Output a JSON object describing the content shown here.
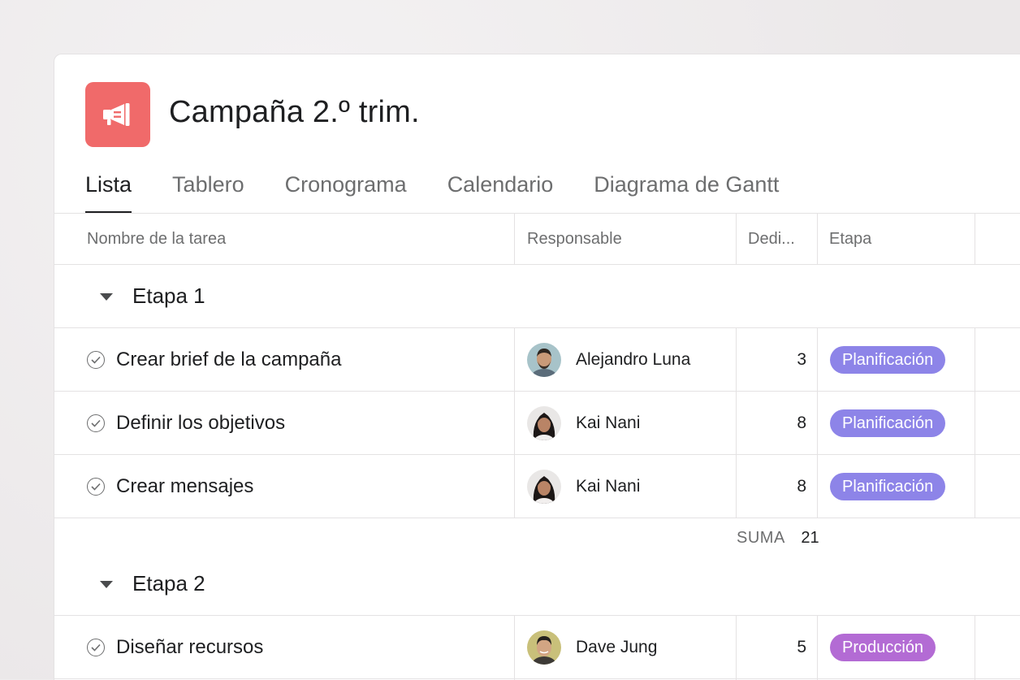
{
  "project": {
    "title": "Campaña 2.º trim.",
    "icon": "megaphone-icon",
    "icon_color": "#f06a6a"
  },
  "tabs": [
    {
      "label": "Lista",
      "active": true
    },
    {
      "label": "Tablero",
      "active": false
    },
    {
      "label": "Cronograma",
      "active": false
    },
    {
      "label": "Calendario",
      "active": false
    },
    {
      "label": "Diagrama de Gantt",
      "active": false
    }
  ],
  "columns": {
    "task": "Nombre de la tarea",
    "assignee": "Responsable",
    "effort": "Dedi...",
    "stage": "Etapa"
  },
  "sections": [
    {
      "label": "Etapa 1",
      "tasks": [
        {
          "name": "Crear brief de la campaña",
          "assignee": "Alejandro Luna",
          "effort": "3",
          "stage": "Planificación"
        },
        {
          "name": "Definir los objetivos",
          "assignee": "Kai Nani",
          "effort": "8",
          "stage": "Planificación"
        },
        {
          "name": "Crear mensajes",
          "assignee": "Kai Nani",
          "effort": "8",
          "stage": "Planificación"
        }
      ],
      "sum_label": "SUMA",
      "sum_value": "21"
    },
    {
      "label": "Etapa 2",
      "tasks": [
        {
          "name": "Diseñar recursos",
          "assignee": "Dave Jung",
          "effort": "5",
          "stage": "Producción"
        }
      ]
    }
  ],
  "colors": {
    "planificacion": "#8d84e8",
    "produccion": "#b36bd4",
    "accent_text": "#1e1f21",
    "muted_text": "#6d6e6f"
  }
}
